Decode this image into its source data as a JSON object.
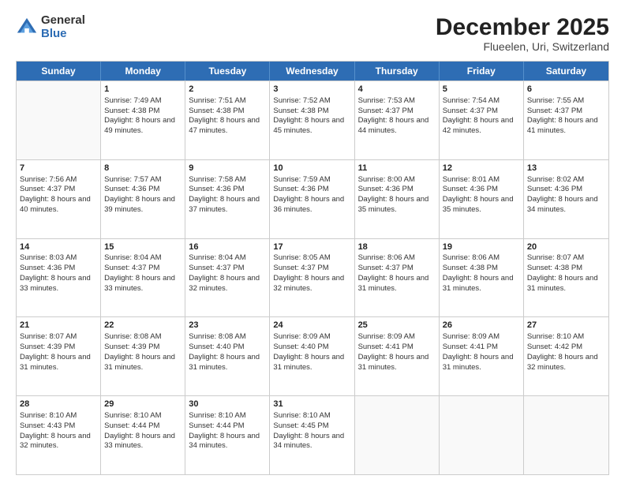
{
  "logo": {
    "general": "General",
    "blue": "Blue"
  },
  "title": "December 2025",
  "subtitle": "Flueelen, Uri, Switzerland",
  "days": [
    "Sunday",
    "Monday",
    "Tuesday",
    "Wednesday",
    "Thursday",
    "Friday",
    "Saturday"
  ],
  "weeks": [
    [
      {
        "day": "",
        "sunrise": "",
        "sunset": "",
        "daylight": ""
      },
      {
        "day": "1",
        "sunrise": "Sunrise: 7:49 AM",
        "sunset": "Sunset: 4:38 PM",
        "daylight": "Daylight: 8 hours and 49 minutes."
      },
      {
        "day": "2",
        "sunrise": "Sunrise: 7:51 AM",
        "sunset": "Sunset: 4:38 PM",
        "daylight": "Daylight: 8 hours and 47 minutes."
      },
      {
        "day": "3",
        "sunrise": "Sunrise: 7:52 AM",
        "sunset": "Sunset: 4:38 PM",
        "daylight": "Daylight: 8 hours and 45 minutes."
      },
      {
        "day": "4",
        "sunrise": "Sunrise: 7:53 AM",
        "sunset": "Sunset: 4:37 PM",
        "daylight": "Daylight: 8 hours and 44 minutes."
      },
      {
        "day": "5",
        "sunrise": "Sunrise: 7:54 AM",
        "sunset": "Sunset: 4:37 PM",
        "daylight": "Daylight: 8 hours and 42 minutes."
      },
      {
        "day": "6",
        "sunrise": "Sunrise: 7:55 AM",
        "sunset": "Sunset: 4:37 PM",
        "daylight": "Daylight: 8 hours and 41 minutes."
      }
    ],
    [
      {
        "day": "7",
        "sunrise": "Sunrise: 7:56 AM",
        "sunset": "Sunset: 4:37 PM",
        "daylight": "Daylight: 8 hours and 40 minutes."
      },
      {
        "day": "8",
        "sunrise": "Sunrise: 7:57 AM",
        "sunset": "Sunset: 4:36 PM",
        "daylight": "Daylight: 8 hours and 39 minutes."
      },
      {
        "day": "9",
        "sunrise": "Sunrise: 7:58 AM",
        "sunset": "Sunset: 4:36 PM",
        "daylight": "Daylight: 8 hours and 37 minutes."
      },
      {
        "day": "10",
        "sunrise": "Sunrise: 7:59 AM",
        "sunset": "Sunset: 4:36 PM",
        "daylight": "Daylight: 8 hours and 36 minutes."
      },
      {
        "day": "11",
        "sunrise": "Sunrise: 8:00 AM",
        "sunset": "Sunset: 4:36 PM",
        "daylight": "Daylight: 8 hours and 35 minutes."
      },
      {
        "day": "12",
        "sunrise": "Sunrise: 8:01 AM",
        "sunset": "Sunset: 4:36 PM",
        "daylight": "Daylight: 8 hours and 35 minutes."
      },
      {
        "day": "13",
        "sunrise": "Sunrise: 8:02 AM",
        "sunset": "Sunset: 4:36 PM",
        "daylight": "Daylight: 8 hours and 34 minutes."
      }
    ],
    [
      {
        "day": "14",
        "sunrise": "Sunrise: 8:03 AM",
        "sunset": "Sunset: 4:36 PM",
        "daylight": "Daylight: 8 hours and 33 minutes."
      },
      {
        "day": "15",
        "sunrise": "Sunrise: 8:04 AM",
        "sunset": "Sunset: 4:37 PM",
        "daylight": "Daylight: 8 hours and 33 minutes."
      },
      {
        "day": "16",
        "sunrise": "Sunrise: 8:04 AM",
        "sunset": "Sunset: 4:37 PM",
        "daylight": "Daylight: 8 hours and 32 minutes."
      },
      {
        "day": "17",
        "sunrise": "Sunrise: 8:05 AM",
        "sunset": "Sunset: 4:37 PM",
        "daylight": "Daylight: 8 hours and 32 minutes."
      },
      {
        "day": "18",
        "sunrise": "Sunrise: 8:06 AM",
        "sunset": "Sunset: 4:37 PM",
        "daylight": "Daylight: 8 hours and 31 minutes."
      },
      {
        "day": "19",
        "sunrise": "Sunrise: 8:06 AM",
        "sunset": "Sunset: 4:38 PM",
        "daylight": "Daylight: 8 hours and 31 minutes."
      },
      {
        "day": "20",
        "sunrise": "Sunrise: 8:07 AM",
        "sunset": "Sunset: 4:38 PM",
        "daylight": "Daylight: 8 hours and 31 minutes."
      }
    ],
    [
      {
        "day": "21",
        "sunrise": "Sunrise: 8:07 AM",
        "sunset": "Sunset: 4:39 PM",
        "daylight": "Daylight: 8 hours and 31 minutes."
      },
      {
        "day": "22",
        "sunrise": "Sunrise: 8:08 AM",
        "sunset": "Sunset: 4:39 PM",
        "daylight": "Daylight: 8 hours and 31 minutes."
      },
      {
        "day": "23",
        "sunrise": "Sunrise: 8:08 AM",
        "sunset": "Sunset: 4:40 PM",
        "daylight": "Daylight: 8 hours and 31 minutes."
      },
      {
        "day": "24",
        "sunrise": "Sunrise: 8:09 AM",
        "sunset": "Sunset: 4:40 PM",
        "daylight": "Daylight: 8 hours and 31 minutes."
      },
      {
        "day": "25",
        "sunrise": "Sunrise: 8:09 AM",
        "sunset": "Sunset: 4:41 PM",
        "daylight": "Daylight: 8 hours and 31 minutes."
      },
      {
        "day": "26",
        "sunrise": "Sunrise: 8:09 AM",
        "sunset": "Sunset: 4:41 PM",
        "daylight": "Daylight: 8 hours and 31 minutes."
      },
      {
        "day": "27",
        "sunrise": "Sunrise: 8:10 AM",
        "sunset": "Sunset: 4:42 PM",
        "daylight": "Daylight: 8 hours and 32 minutes."
      }
    ],
    [
      {
        "day": "28",
        "sunrise": "Sunrise: 8:10 AM",
        "sunset": "Sunset: 4:43 PM",
        "daylight": "Daylight: 8 hours and 32 minutes."
      },
      {
        "day": "29",
        "sunrise": "Sunrise: 8:10 AM",
        "sunset": "Sunset: 4:44 PM",
        "daylight": "Daylight: 8 hours and 33 minutes."
      },
      {
        "day": "30",
        "sunrise": "Sunrise: 8:10 AM",
        "sunset": "Sunset: 4:44 PM",
        "daylight": "Daylight: 8 hours and 34 minutes."
      },
      {
        "day": "31",
        "sunrise": "Sunrise: 8:10 AM",
        "sunset": "Sunset: 4:45 PM",
        "daylight": "Daylight: 8 hours and 34 minutes."
      },
      {
        "day": "",
        "sunrise": "",
        "sunset": "",
        "daylight": ""
      },
      {
        "day": "",
        "sunrise": "",
        "sunset": "",
        "daylight": ""
      },
      {
        "day": "",
        "sunrise": "",
        "sunset": "",
        "daylight": ""
      }
    ]
  ]
}
